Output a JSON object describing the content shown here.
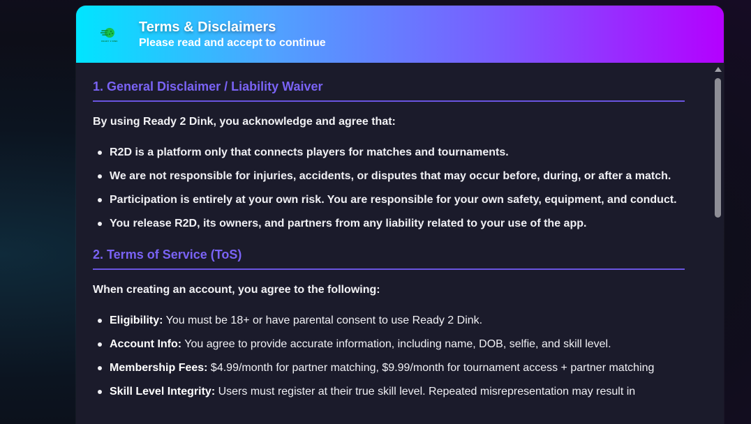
{
  "header": {
    "logo_text": "READY 2 DINK",
    "title": "Terms & Disclaimers",
    "subtitle": "Please read and accept to continue"
  },
  "sections": [
    {
      "title": "1. General Disclaimer / Liability Waiver",
      "intro": "By using Ready 2 Dink, you acknowledge and agree that:",
      "items": [
        "R2D is a platform only that connects players for matches and tournaments.",
        "We are not responsible for injuries, accidents, or disputes that may occur before, during, or after a match.",
        "Participation is entirely at your own risk. You are responsible for your own safety, equipment, and conduct.",
        "You release R2D, its owners, and partners from any liability related to your use of the app."
      ]
    },
    {
      "title": "2. Terms of Service (ToS)",
      "intro": "When creating an account, you agree to the following:",
      "items": [
        {
          "term": "Eligibility:",
          "desc": " You must be 18+ or have parental consent to use Ready 2 Dink."
        },
        {
          "term": "Account Info:",
          "desc": " You agree to provide accurate information, including name, DOB, selfie, and skill level."
        },
        {
          "term": "Membership Fees:",
          "desc": " $4.99/month for partner matching, $9.99/month for tournament access + partner matching"
        },
        {
          "term": "Skill Level Integrity:",
          "desc": " Users must register at their true skill level. Repeated misrepresentation may result in"
        }
      ]
    }
  ],
  "colors": {
    "header_gradient_start": "#00e5ff",
    "header_gradient_end": "#b400ff",
    "section_title": "#7a63f5",
    "panel_bg": "#1b1b2b"
  },
  "icons": {
    "logo": "ready-2-dink-logo",
    "scroll_up": "scroll-up-arrow-icon"
  }
}
